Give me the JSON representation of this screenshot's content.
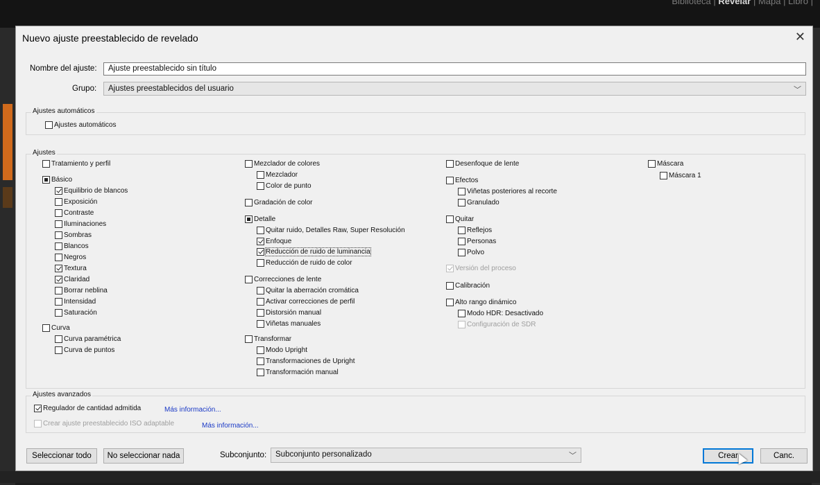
{
  "background": {
    "modules": [
      "Biblioteca",
      "Revelar",
      "Mapa",
      "Libro"
    ],
    "active_module": "Revelar"
  },
  "dialog": {
    "title": "Nuevo ajuste preestablecido de revelado",
    "name_label": "Nombre del ajuste:",
    "name_value": "Ajuste preestablecido sin título",
    "group_label": "Grupo:",
    "group_value": "Ajustes preestablecidos del usuario"
  },
  "auto_section": {
    "label": "Ajustes automáticos",
    "checkbox": "Ajustes automáticos"
  },
  "settings_section": {
    "label": "Ajustes",
    "col1": {
      "tratamiento": "Tratamiento y perfil",
      "basico": "Básico",
      "equilibrio": "Equilibrio de blancos",
      "exposicion": "Exposición",
      "contraste": "Contraste",
      "iluminaciones": "Iluminaciones",
      "sombras": "Sombras",
      "blancos": "Blancos",
      "negros": "Negros",
      "textura": "Textura",
      "claridad": "Claridad",
      "neblina": "Borrar neblina",
      "intensidad": "Intensidad",
      "saturacion": "Saturación",
      "curva": "Curva",
      "curva_param": "Curva paramétrica",
      "curva_puntos": "Curva de puntos"
    },
    "col2": {
      "mezclador_colores": "Mezclador de colores",
      "mezclador": "Mezclador",
      "color_punto": "Color de punto",
      "gradacion": "Gradación de color",
      "detalle": "Detalle",
      "quitar_ruido": "Quitar ruido, Detalles Raw, Super Resolución",
      "enfoque": "Enfoque",
      "ruido_luminancia": "Reducción de ruido de luminancia",
      "ruido_color": "Reducción de ruido de color",
      "correcciones": "Correcciones de lente",
      "aberracion": "Quitar la aberración cromática",
      "perfil": "Activar correcciones de perfil",
      "distorsion": "Distorsión manual",
      "vinetas_manuales": "Viñetas manuales",
      "transformar": "Transformar",
      "modo_upright": "Modo Upright",
      "transf_upright": "Transformaciones de Upright",
      "transf_manual": "Transformación manual"
    },
    "col3": {
      "desenfoque": "Desenfoque de lente",
      "efectos": "Efectos",
      "vinetas_post": "Viñetas posteriores al recorte",
      "granulado": "Granulado",
      "quitar": "Quitar",
      "reflejos": "Reflejos",
      "personas": "Personas",
      "polvo": "Polvo",
      "version": "Versión del proceso",
      "calibracion": "Calibración",
      "hdr": "Alto rango dinámico",
      "modo_hdr": "Modo HDR: Desactivado",
      "config_sdr": "Configuración de SDR"
    },
    "col4": {
      "mascara": "Máscara",
      "mascara1": "Máscara 1"
    }
  },
  "advanced_section": {
    "label": "Ajustes avanzados",
    "regulador": "Regulador de cantidad admitida",
    "mas_info_1": "Más información...",
    "iso": "Crear ajuste preestablecido ISO adaptable",
    "mas_info_2": "Más información..."
  },
  "footer": {
    "select_all": "Seleccionar todo",
    "select_none": "No seleccionar nada",
    "subset_label": "Subconjunto:",
    "subset_value": "Subconjunto personalizado",
    "create": "Crear",
    "cancel": "Canc."
  }
}
